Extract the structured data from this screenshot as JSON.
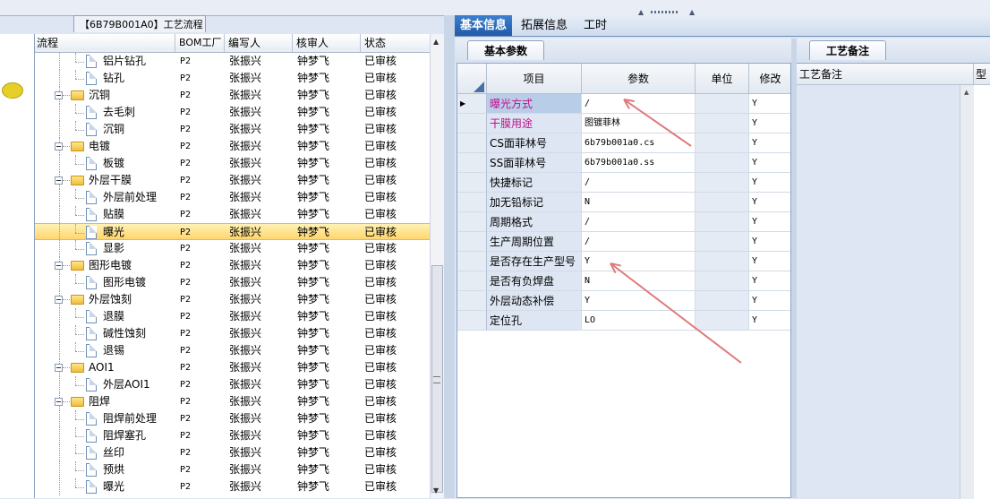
{
  "tree_panel": {
    "title": "【6B79B001A0】工艺流程",
    "columns": [
      "流程",
      "BOM工厂",
      "编写人",
      "核审人",
      "状态"
    ],
    "rows": [
      {
        "name": "铝片钻孔",
        "bom": "P2",
        "writer": "张振兴",
        "reviewer": "钟梦飞",
        "status": "已审核",
        "kind": "leaf"
      },
      {
        "name": "钻孔",
        "bom": "P2",
        "writer": "张振兴",
        "reviewer": "钟梦飞",
        "status": "已审核",
        "kind": "leaf"
      },
      {
        "name": "沉铜",
        "bom": "P2",
        "writer": "张振兴",
        "reviewer": "钟梦飞",
        "status": "已审核",
        "kind": "folder"
      },
      {
        "name": "去毛刺",
        "bom": "P2",
        "writer": "张振兴",
        "reviewer": "钟梦飞",
        "status": "已审核",
        "kind": "leaf"
      },
      {
        "name": "沉铜",
        "bom": "P2",
        "writer": "张振兴",
        "reviewer": "钟梦飞",
        "status": "已审核",
        "kind": "leaf"
      },
      {
        "name": "电镀",
        "bom": "P2",
        "writer": "张振兴",
        "reviewer": "钟梦飞",
        "status": "已审核",
        "kind": "folder"
      },
      {
        "name": "板镀",
        "bom": "P2",
        "writer": "张振兴",
        "reviewer": "钟梦飞",
        "status": "已审核",
        "kind": "leaf"
      },
      {
        "name": "外层干膜",
        "bom": "P2",
        "writer": "张振兴",
        "reviewer": "钟梦飞",
        "status": "已审核",
        "kind": "folder"
      },
      {
        "name": "外层前处理",
        "bom": "P2",
        "writer": "张振兴",
        "reviewer": "钟梦飞",
        "status": "已审核",
        "kind": "leaf"
      },
      {
        "name": "贴膜",
        "bom": "P2",
        "writer": "张振兴",
        "reviewer": "钟梦飞",
        "status": "已审核",
        "kind": "leaf"
      },
      {
        "name": "曝光",
        "bom": "P2",
        "writer": "张振兴",
        "reviewer": "钟梦飞",
        "status": "已审核",
        "kind": "leaf",
        "selected": true
      },
      {
        "name": "显影",
        "bom": "P2",
        "writer": "张振兴",
        "reviewer": "钟梦飞",
        "status": "已审核",
        "kind": "leaf"
      },
      {
        "name": "图形电镀",
        "bom": "P2",
        "writer": "张振兴",
        "reviewer": "钟梦飞",
        "status": "已审核",
        "kind": "folder"
      },
      {
        "name": "图形电镀",
        "bom": "P2",
        "writer": "张振兴",
        "reviewer": "钟梦飞",
        "status": "已审核",
        "kind": "leaf"
      },
      {
        "name": "外层蚀刻",
        "bom": "P2",
        "writer": "张振兴",
        "reviewer": "钟梦飞",
        "status": "已审核",
        "kind": "folder"
      },
      {
        "name": "退膜",
        "bom": "P2",
        "writer": "张振兴",
        "reviewer": "钟梦飞",
        "status": "已审核",
        "kind": "leaf"
      },
      {
        "name": "碱性蚀刻",
        "bom": "P2",
        "writer": "张振兴",
        "reviewer": "钟梦飞",
        "status": "已审核",
        "kind": "leaf"
      },
      {
        "name": "退锡",
        "bom": "P2",
        "writer": "张振兴",
        "reviewer": "钟梦飞",
        "status": "已审核",
        "kind": "leaf"
      },
      {
        "name": "AOI1",
        "bom": "P2",
        "writer": "张振兴",
        "reviewer": "钟梦飞",
        "status": "已审核",
        "kind": "folder"
      },
      {
        "name": "外层AOI1",
        "bom": "P2",
        "writer": "张振兴",
        "reviewer": "钟梦飞",
        "status": "已审核",
        "kind": "leaf"
      },
      {
        "name": "阻焊",
        "bom": "P2",
        "writer": "张振兴",
        "reviewer": "钟梦飞",
        "status": "已审核",
        "kind": "folder"
      },
      {
        "name": "阻焊前处理",
        "bom": "P2",
        "writer": "张振兴",
        "reviewer": "钟梦飞",
        "status": "已审核",
        "kind": "leaf"
      },
      {
        "name": "阻焊塞孔",
        "bom": "P2",
        "writer": "张振兴",
        "reviewer": "钟梦飞",
        "status": "已审核",
        "kind": "leaf"
      },
      {
        "name": "丝印",
        "bom": "P2",
        "writer": "张振兴",
        "reviewer": "钟梦飞",
        "status": "已审核",
        "kind": "leaf"
      },
      {
        "name": "预烘",
        "bom": "P2",
        "writer": "张振兴",
        "reviewer": "钟梦飞",
        "status": "已审核",
        "kind": "leaf"
      },
      {
        "name": "曝光",
        "bom": "P2",
        "writer": "张振兴",
        "reviewer": "钟梦飞",
        "status": "已审核",
        "kind": "leaf"
      }
    ]
  },
  "top_tabs": [
    "基本信息",
    "拓展信息",
    "工时"
  ],
  "param_panel": {
    "tab": "基本参数",
    "columns": [
      "项目",
      "参数",
      "单位",
      "修改"
    ],
    "rows": [
      {
        "item": "曝光方式",
        "value": "/",
        "unit": "",
        "modify": "Y",
        "color": "#c0108e",
        "current": true
      },
      {
        "item": "干膜用途",
        "value": "图镀菲林",
        "unit": "",
        "modify": "Y",
        "color": "#c0108e"
      },
      {
        "item": "CS面菲林号",
        "value": "6b79b001a0.cs",
        "unit": "",
        "modify": "Y"
      },
      {
        "item": "SS面菲林号",
        "value": "6b79b001a0.ss",
        "unit": "",
        "modify": "Y"
      },
      {
        "item": "快捷标记",
        "value": "/",
        "unit": "",
        "modify": "Y"
      },
      {
        "item": "加无铅标记",
        "value": "N",
        "unit": "",
        "modify": "Y"
      },
      {
        "item": "周期格式",
        "value": "/",
        "unit": "",
        "modify": "Y"
      },
      {
        "item": "生产周期位置",
        "value": "/",
        "unit": "",
        "modify": "Y"
      },
      {
        "item": "是否存在生产型号",
        "value": "Y",
        "unit": "",
        "modify": "Y"
      },
      {
        "item": "是否有负焊盘",
        "value": "N",
        "unit": "",
        "modify": "Y"
      },
      {
        "item": "外层动态补偿",
        "value": "Y",
        "unit": "",
        "modify": "Y"
      },
      {
        "item": "定位孔",
        "value": "LO",
        "unit": "",
        "modify": "Y"
      }
    ]
  },
  "remark_panel": {
    "tab": "工艺备注",
    "col1": "工艺备注",
    "col2": "型号"
  },
  "colors": {
    "accent": "#1f5ba7",
    "selection": "#ffd66e",
    "annotation_arrow": "#e07a7a"
  }
}
